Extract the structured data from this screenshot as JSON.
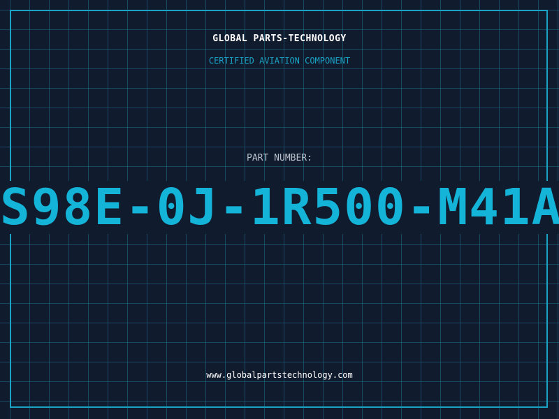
{
  "header": {
    "company": "GLOBAL PARTS-TECHNOLOGY",
    "tagline": "CERTIFIED AVIATION COMPONENT"
  },
  "part": {
    "label": "PART NUMBER:",
    "number": "S98E-0J-1R500-M41A"
  },
  "footer": {
    "website": "www.globalpartstechnology.com"
  },
  "colors": {
    "background": "#111b2e",
    "grid": "#1e6e8c",
    "accent": "#14b4d8",
    "title": "#ffffff",
    "label": "#b8c2cc"
  }
}
